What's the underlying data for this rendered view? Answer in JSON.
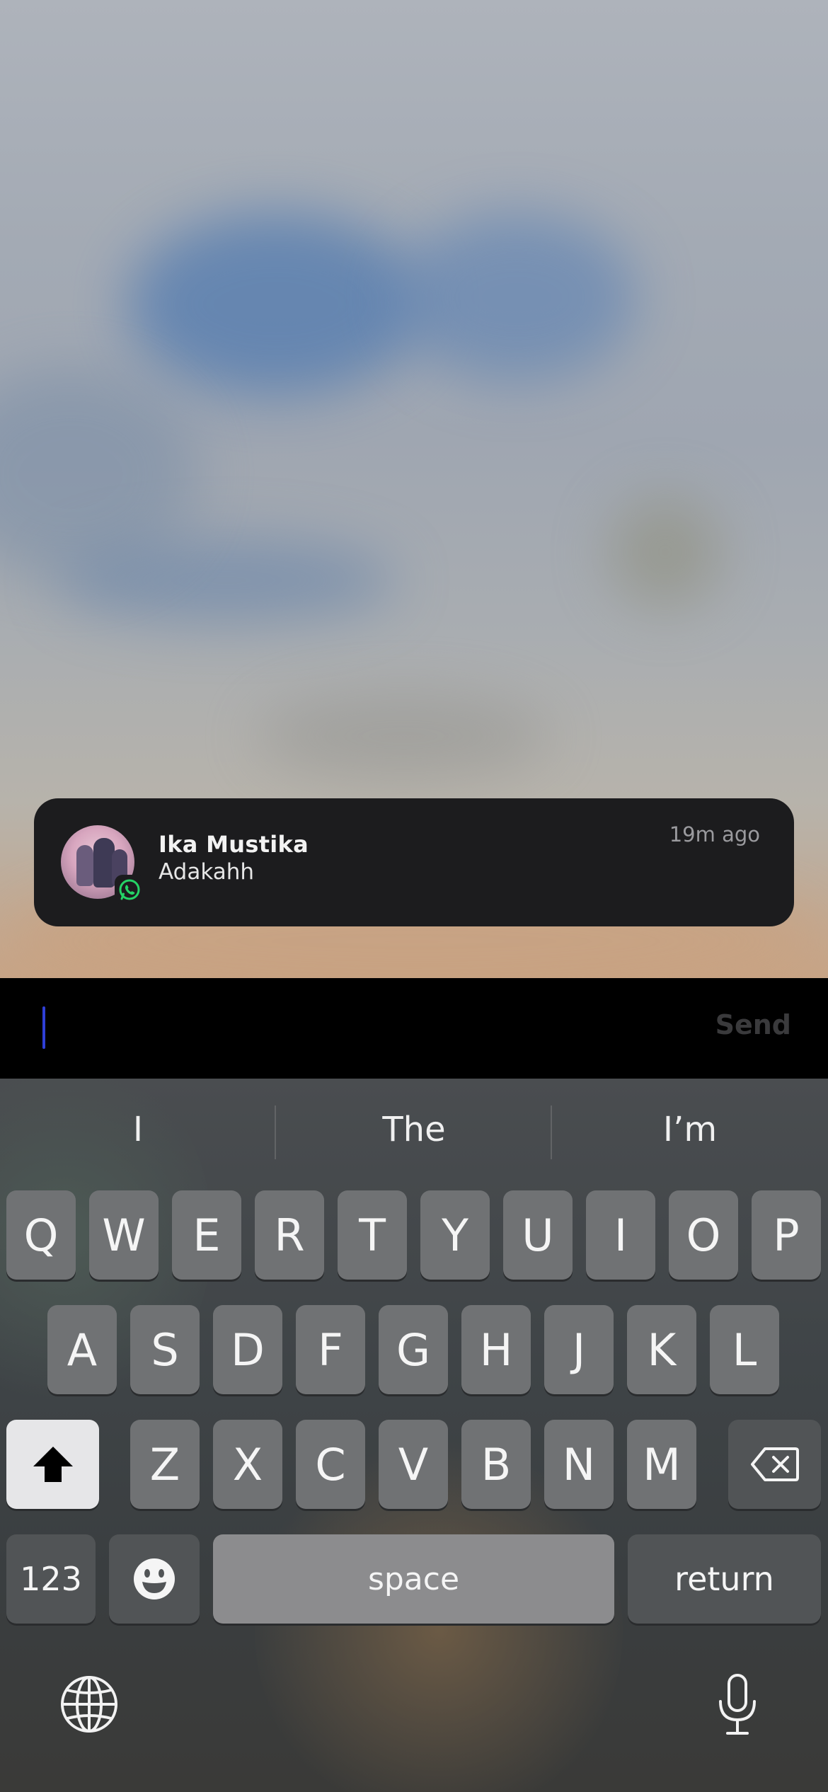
{
  "notification": {
    "sender": "Ika Mustika",
    "message": "Adakahh",
    "time": "19m ago",
    "app_icon": "whatsapp-icon"
  },
  "reply": {
    "send_label": "Send"
  },
  "keyboard": {
    "suggestions": [
      "I",
      "The",
      "I’m"
    ],
    "row1": [
      "Q",
      "W",
      "E",
      "R",
      "T",
      "Y",
      "U",
      "I",
      "O",
      "P"
    ],
    "row2": [
      "A",
      "S",
      "D",
      "F",
      "G",
      "H",
      "J",
      "K",
      "L"
    ],
    "row3": [
      "Z",
      "X",
      "C",
      "V",
      "B",
      "N",
      "M"
    ],
    "numbers_label": "123",
    "space_label": "space",
    "return_label": "return",
    "icons": {
      "shift": "shift-icon",
      "delete": "backspace-icon",
      "emoji": "emoji-icon",
      "globe": "globe-icon",
      "mic": "microphone-icon"
    }
  },
  "colors": {
    "whatsapp_green": "#25D366",
    "cursor": "#2f3fd6"
  }
}
